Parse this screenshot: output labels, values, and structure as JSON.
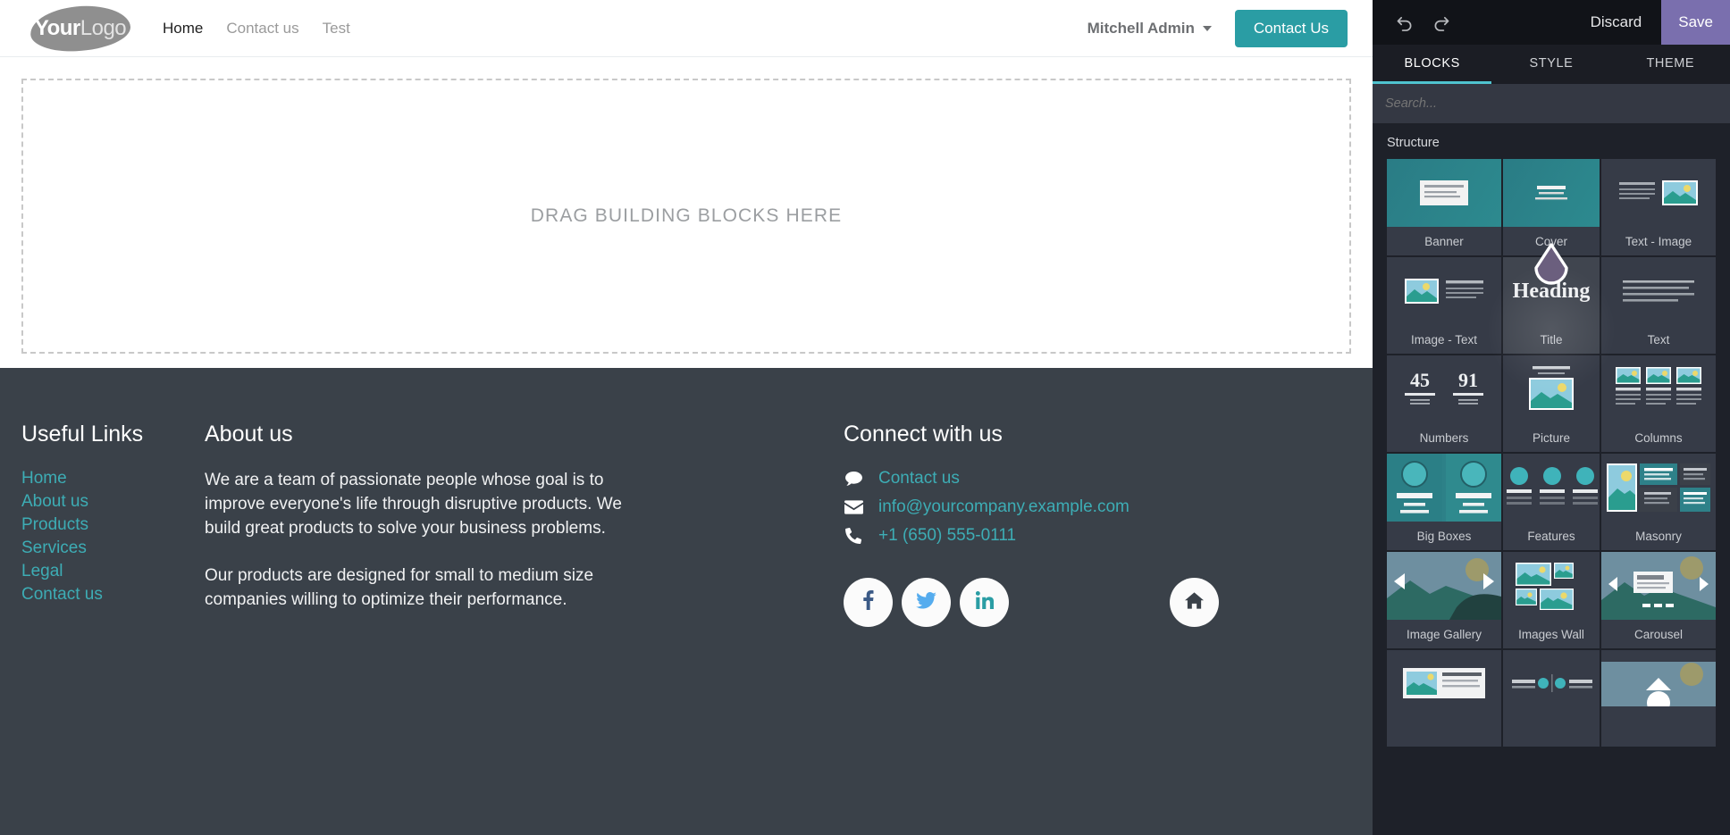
{
  "site": {
    "logo": {
      "bold_part": "Your",
      "light_part": "Logo",
      "icon": "logo-blob"
    },
    "nav": [
      {
        "label": "Home",
        "active": true
      },
      {
        "label": "Contact us",
        "active": false
      },
      {
        "label": "Test",
        "active": false
      }
    ],
    "user_menu": {
      "label": "Mitchell Admin",
      "icon": "chevron-down-icon"
    },
    "cta_button": {
      "label": "Contact Us"
    },
    "dropzone": {
      "label": "DRAG BUILDING BLOCKS HERE"
    },
    "footer": {
      "useful_links": {
        "title": "Useful Links",
        "items": [
          "Home",
          "About us",
          "Products",
          "Services",
          "Legal",
          "Contact us"
        ]
      },
      "about": {
        "title": "About us",
        "paragraphs": [
          "We are a team of passionate people whose goal is to improve everyone's life through disruptive products. We build great products to solve your business problems.",
          "Our products are designed for small to medium size companies willing to optimize their performance."
        ]
      },
      "connect": {
        "title": "Connect with us",
        "rows": [
          {
            "icon": "comment-icon",
            "label": "Contact us"
          },
          {
            "icon": "envelope-icon",
            "label": "info@yourcompany.example.com"
          },
          {
            "icon": "phone-icon",
            "label": "+1 (650) 555-0111"
          }
        ],
        "social": [
          {
            "icon": "facebook-icon",
            "name": "Facebook",
            "color": "#3b5a86"
          },
          {
            "icon": "twitter-icon",
            "name": "Twitter",
            "color": "#55acee"
          },
          {
            "icon": "linkedin-icon",
            "name": "LinkedIn",
            "color": "#2a9da4"
          }
        ],
        "home_button": {
          "icon": "home-icon",
          "name": "Home"
        }
      }
    }
  },
  "editor": {
    "topbar": {
      "undo": {
        "icon": "undo-icon",
        "label": "↺"
      },
      "redo": {
        "icon": "redo-icon",
        "label": "↻"
      },
      "discard_label": "Discard",
      "save_label": "Save"
    },
    "tabs": [
      {
        "label": "BLOCKS",
        "active": true
      },
      {
        "label": "STYLE",
        "active": false
      },
      {
        "label": "THEME",
        "active": false
      }
    ],
    "search": {
      "placeholder": "Search...",
      "value": ""
    },
    "section_title": "Structure",
    "blocks": [
      {
        "label": "Banner",
        "style": "teal"
      },
      {
        "label": "Cover",
        "style": "teal"
      },
      {
        "label": "Text - Image",
        "style": "plain"
      },
      {
        "label": "Image - Text",
        "style": "plain"
      },
      {
        "label": "Title",
        "style": "plain",
        "sample_text": "Heading",
        "dragging": true
      },
      {
        "label": "Text",
        "style": "plain"
      },
      {
        "label": "Numbers",
        "style": "plain",
        "sample_numbers": [
          "45",
          "91"
        ]
      },
      {
        "label": "Picture",
        "style": "plain"
      },
      {
        "label": "Columns",
        "style": "plain"
      },
      {
        "label": "Big Boxes",
        "style": "teal"
      },
      {
        "label": "Features",
        "style": "plain"
      },
      {
        "label": "Masonry",
        "style": "plain"
      },
      {
        "label": "Image Gallery",
        "style": "photo"
      },
      {
        "label": "Images Wall",
        "style": "plain"
      },
      {
        "label": "Carousel",
        "style": "photo"
      }
    ]
  },
  "colors": {
    "accent_teal": "#2a9da4",
    "link_teal": "#3dadb5",
    "footer_bg": "#3a4149",
    "save_purple": "#7a6fae",
    "panel_bg": "#1e2129",
    "tab_active": "#4fc3cf"
  }
}
